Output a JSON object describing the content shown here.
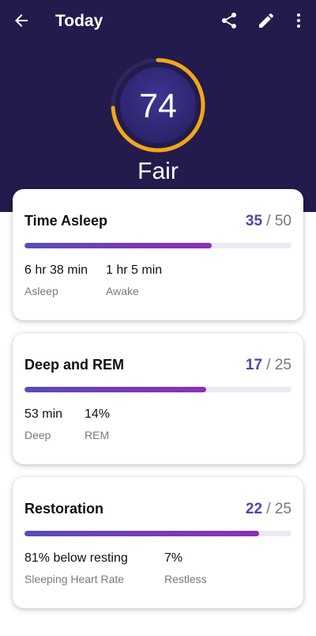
{
  "header": {
    "title": "Today",
    "icons": {
      "back": "arrow-back-icon",
      "share": "share-icon",
      "edit": "pencil-icon",
      "more": "more-vert-icon"
    }
  },
  "score": {
    "value": "74",
    "label": "Fair",
    "progress_fraction": 0.74
  },
  "cards": [
    {
      "title": "Time Asleep",
      "score": "35",
      "max": "50",
      "fraction": 0.7,
      "stats": [
        {
          "value": "6 hr 38 min",
          "label": "Asleep"
        },
        {
          "value": "1 hr 5 min",
          "label": "Awake"
        }
      ]
    },
    {
      "title": "Deep and REM",
      "score": "17",
      "max": "25",
      "fraction": 0.68,
      "stats": [
        {
          "value": "53 min",
          "label": "Deep"
        },
        {
          "value": "14%",
          "label": "REM"
        }
      ]
    },
    {
      "title": "Restoration",
      "score": "22",
      "max": "25",
      "fraction": 0.88,
      "stats": [
        {
          "value": "81% below resting",
          "label": "Sleeping Heart Rate"
        },
        {
          "value": "7%",
          "label": "Restless"
        }
      ]
    }
  ],
  "colors": {
    "header_bg": "#231b4c",
    "ring_accent": "#f2a71b",
    "score_value": "#5144a6",
    "bar_start": "#5a4bb8",
    "bar_end": "#8e2fb3"
  }
}
